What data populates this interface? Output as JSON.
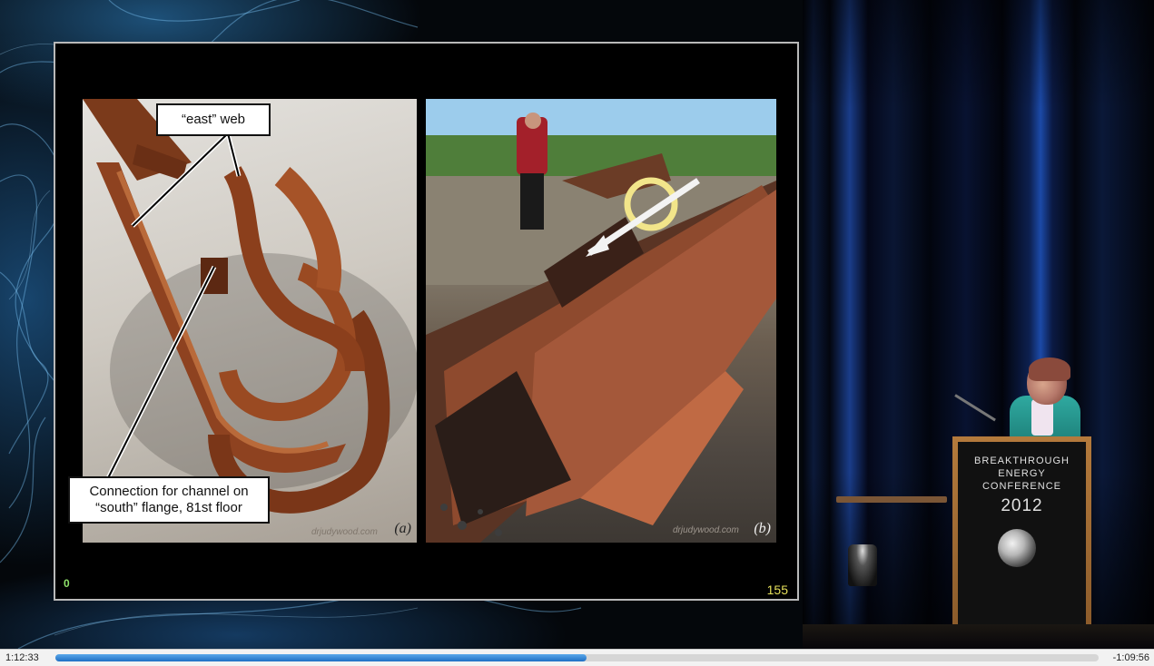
{
  "player": {
    "elapsed": "1:12:33",
    "remaining": "-1:09:56",
    "progress": 0.509,
    "accent_color": "#2a7fd4"
  },
  "slide": {
    "number_left": "0",
    "number_right": "155",
    "panel_a": {
      "label_top": "“east” web",
      "label_bottom_line1": "Connection for channel on",
      "label_bottom_line2": "“south” flange, 81st floor",
      "tag": "(a)",
      "watermark": "drjudywood.com"
    },
    "panel_b": {
      "tag": "(b)",
      "watermark": "drjudywood.com"
    }
  },
  "podium": {
    "line1": "BREAKTHROUGH",
    "line2": "ENERGY",
    "line3": "CONFERENCE",
    "year": "2012"
  }
}
